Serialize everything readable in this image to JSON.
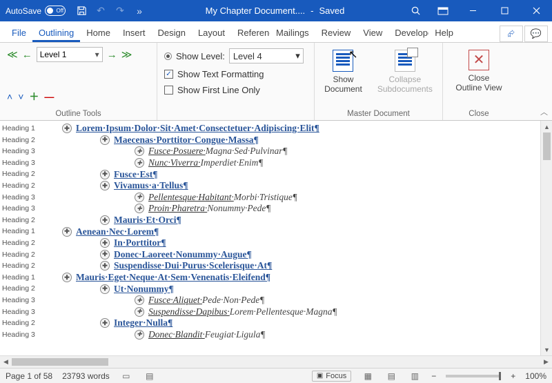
{
  "titlebar": {
    "autosave_label": "AutoSave",
    "autosave_state": "Off",
    "doc_title": "My Chapter Document....",
    "save_state": "Saved",
    "separator": "-"
  },
  "tabs": {
    "file": "File",
    "outlining": "Outlining",
    "home": "Home",
    "insert": "Insert",
    "design": "Design",
    "layout": "Layout",
    "references": "References",
    "mailings": "Mailings",
    "review": "Review",
    "view": "View",
    "developer": "Developer",
    "help": "Help"
  },
  "ribbon": {
    "outline_tools": {
      "label": "Outline Tools",
      "level_value": "Level 1",
      "show_level_label": "Show Level:",
      "show_level_value": "Level 4",
      "show_text_fmt": "Show Text Formatting",
      "show_first_line": "Show First Line Only"
    },
    "master": {
      "label": "Master Document",
      "show_line1": "Show",
      "show_line2": "Document",
      "collapse_line1": "Collapse",
      "collapse_line2": "Subdocuments"
    },
    "close": {
      "label": "Close",
      "line1": "Close",
      "line2": "Outline View"
    }
  },
  "style_labels": {
    "h1": "Heading 1",
    "h2": "Heading 2",
    "h3": "Heading 3"
  },
  "outline": [
    {
      "level": 1,
      "text": "Lorem·Ipsum·Dolor·Sit·Amet·Consectetuer·Adipiscing·Elit¶"
    },
    {
      "level": 2,
      "text": "Maecenas·Porttitor·Congue·Massa¶"
    },
    {
      "level": 3,
      "u": "Fusce·Posuere·",
      "rest": "Magna·Sed·Pulvinar¶"
    },
    {
      "level": 3,
      "u": "Nunc·Viverra·",
      "rest": "Imperdiet·Enim¶"
    },
    {
      "level": 2,
      "text": "Fusce·Est¶"
    },
    {
      "level": 2,
      "text": "Vivamus·a·Tellus¶"
    },
    {
      "level": 3,
      "u": "Pellentesque·Habitant·",
      "rest": "Morbi·Tristique¶"
    },
    {
      "level": 3,
      "u": "Proin·Pharetra·",
      "rest": "Nonummy·Pede¶"
    },
    {
      "level": 2,
      "text": "Mauris·Et·Orci¶"
    },
    {
      "level": 1,
      "text": "Aenean·Nec·Lorem¶"
    },
    {
      "level": 2,
      "text": "In·Porttitor¶"
    },
    {
      "level": 2,
      "text": "Donec·Laoreet·Nonummy·Augue¶"
    },
    {
      "level": 2,
      "text": "Suspendisse·Dui·Purus·Scelerisque·At¶"
    },
    {
      "level": 1,
      "text": "Mauris·Eget·Neque·At·Sem·Venenatis·Eleifend¶"
    },
    {
      "level": 2,
      "text": "Ut·Nonummy¶"
    },
    {
      "level": 3,
      "u": "Fusce·Aliquet·",
      "rest": "Pede·Non·Pede¶"
    },
    {
      "level": 3,
      "u": "Suspendisse·Dapibus·",
      "rest": "Lorem·Pellentesque·Magna¶"
    },
    {
      "level": 2,
      "text": "Integer·Nulla¶"
    },
    {
      "level": 3,
      "u": "Donec·Blandit·",
      "rest": "Feugiat·Ligula¶"
    }
  ],
  "status": {
    "page": "Page 1 of 58",
    "words": "23793 words",
    "focus": "Focus",
    "zoom": "100%"
  }
}
